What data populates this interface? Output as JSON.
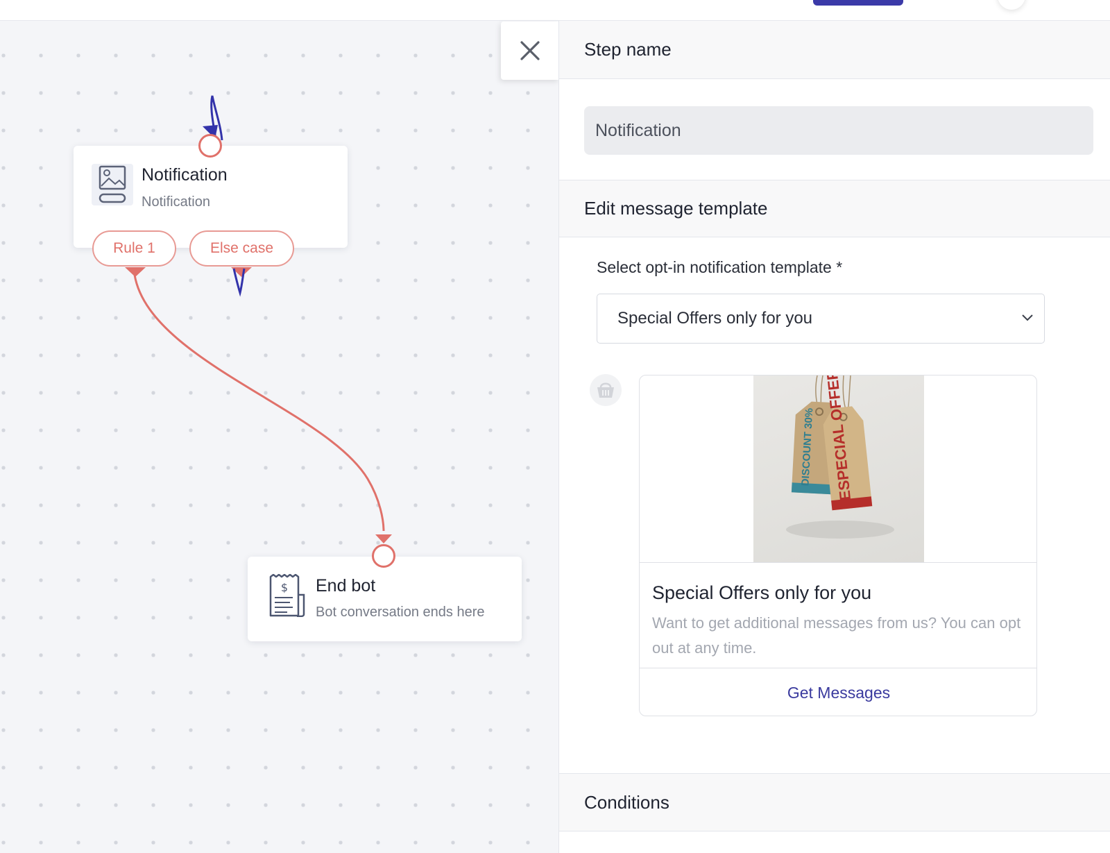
{
  "close_label": "×",
  "canvas": {
    "nodes": [
      {
        "title": "Notification",
        "subtitle": "Notification",
        "icon": "image-card-icon"
      },
      {
        "title": "End bot",
        "subtitle": "Bot conversation ends here",
        "icon": "receipt-icon"
      }
    ],
    "rules": [
      "Rule 1",
      "Else case"
    ],
    "colors": {
      "edge": "#e0716a",
      "dangling_edge": "#3333aa"
    }
  },
  "panel": {
    "step_name_header": "Step name",
    "step_name_value": "Notification",
    "edit_template_header": "Edit message template",
    "select_label": "Select opt-in notification template *",
    "select_value": "Special Offers only for you",
    "message": {
      "image_text_left": "DISCOUNT 30%",
      "image_text_right": "ESPECIAL OFFER",
      "title": "Special Offers only for you",
      "body": "Want to get additional messages from us? You can opt out at any time.",
      "button": "Get Messages"
    },
    "conditions_header": "Conditions"
  },
  "colors": {
    "accent": "#3b3aa8",
    "link": "#3a3a9e"
  }
}
